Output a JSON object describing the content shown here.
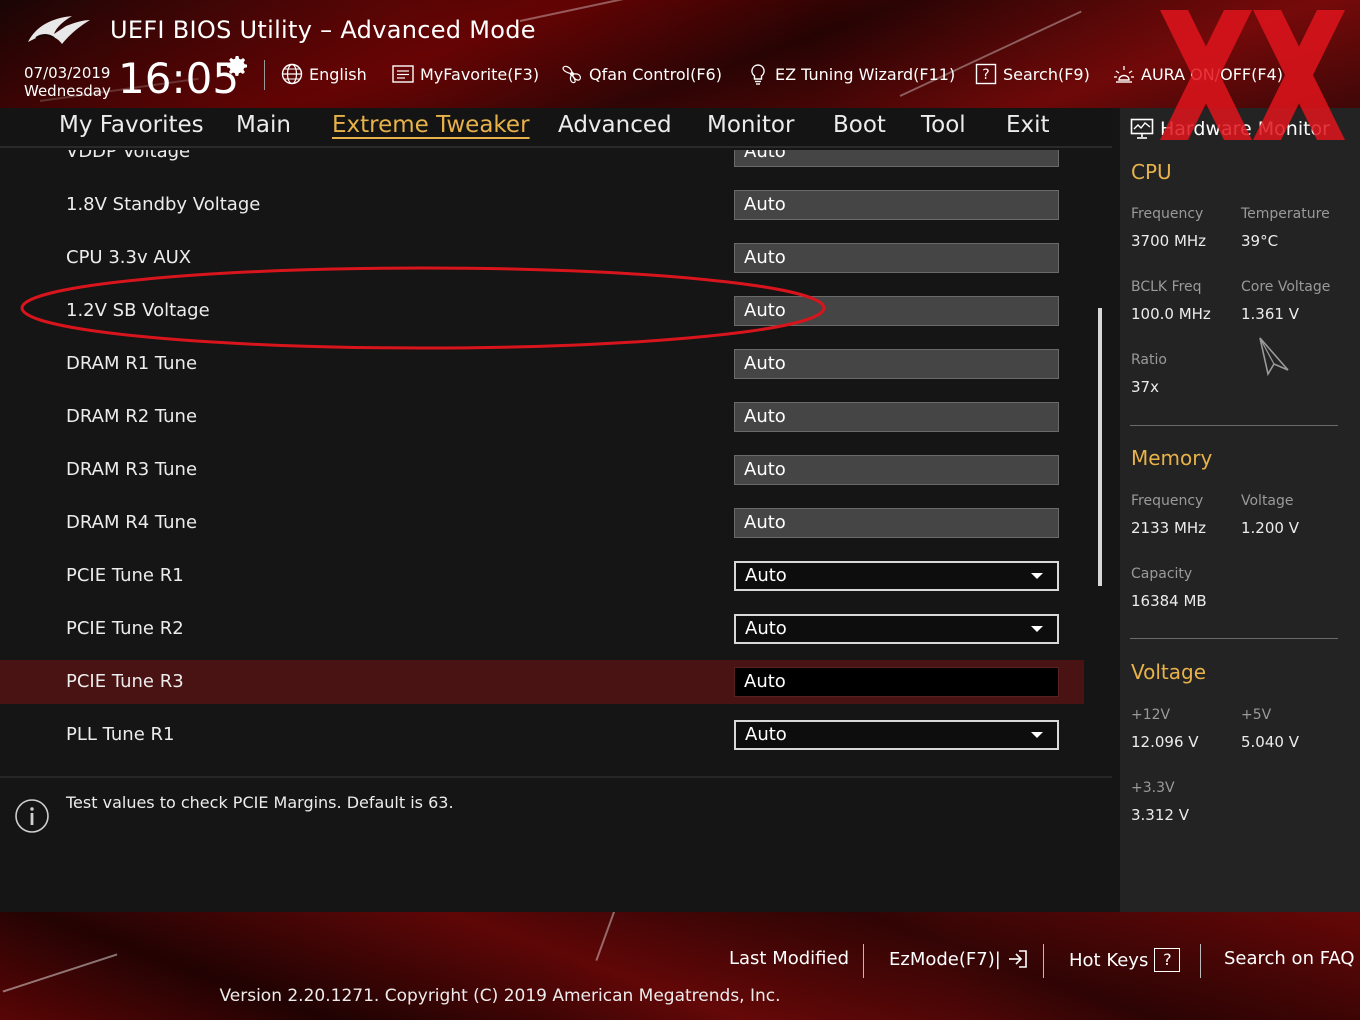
{
  "header": {
    "title": "UEFI BIOS Utility – Advanced Mode",
    "date": "07/03/2019",
    "weekday": "Wednesday",
    "time": "16:05",
    "tools": [
      {
        "label": "English",
        "icon": "globe-icon"
      },
      {
        "label": "MyFavorite(F3)",
        "icon": "favorite-list-icon"
      },
      {
        "label": "Qfan Control(F6)",
        "icon": "fan-icon"
      },
      {
        "label": "EZ Tuning Wizard(F11)",
        "icon": "lightbulb-icon"
      },
      {
        "label": "Search(F9)",
        "icon": "question-box-icon"
      },
      {
        "label": "AURA ON/OFF(F4)",
        "icon": "aura-light-icon"
      }
    ]
  },
  "tabs": [
    {
      "label": "My Favorites",
      "active": false
    },
    {
      "label": "Main",
      "active": false
    },
    {
      "label": "Extreme Tweaker",
      "active": true
    },
    {
      "label": "Advanced",
      "active": false
    },
    {
      "label": "Monitor",
      "active": false
    },
    {
      "label": "Boot",
      "active": false
    },
    {
      "label": "Tool",
      "active": false
    },
    {
      "label": "Exit",
      "active": false
    }
  ],
  "settings": [
    {
      "label": "VDDP Voltage",
      "value": "Auto",
      "kind": "text",
      "selected": false
    },
    {
      "label": "1.8V Standby Voltage",
      "value": "Auto",
      "kind": "text",
      "selected": false
    },
    {
      "label": "CPU 3.3v AUX",
      "value": "Auto",
      "kind": "text",
      "selected": false
    },
    {
      "label": "1.2V SB Voltage",
      "value": "Auto",
      "kind": "text",
      "selected": false
    },
    {
      "label": "DRAM R1 Tune",
      "value": "Auto",
      "kind": "text",
      "selected": false
    },
    {
      "label": "DRAM R2 Tune",
      "value": "Auto",
      "kind": "text",
      "selected": false
    },
    {
      "label": "DRAM R3 Tune",
      "value": "Auto",
      "kind": "text",
      "selected": false
    },
    {
      "label": "DRAM R4 Tune",
      "value": "Auto",
      "kind": "text",
      "selected": false
    },
    {
      "label": "PCIE Tune R1",
      "value": "Auto",
      "kind": "dropdown",
      "selected": false
    },
    {
      "label": "PCIE Tune R2",
      "value": "Auto",
      "kind": "dropdown",
      "selected": false
    },
    {
      "label": "PCIE Tune R3",
      "value": "Auto",
      "kind": "active",
      "selected": true
    },
    {
      "label": "PLL Tune R1",
      "value": "Auto",
      "kind": "dropdown",
      "selected": false
    }
  ],
  "help": {
    "text": "Test values to check PCIE Margins. Default is 63."
  },
  "hardware_monitor": {
    "title": "Hardware Monitor",
    "cpu": {
      "heading": "CPU",
      "frequency_label": "Frequency",
      "frequency": "3700 MHz",
      "temperature_label": "Temperature",
      "temperature": "39°C",
      "bclk_label": "BCLK Freq",
      "bclk": "100.0 MHz",
      "core_voltage_label": "Core Voltage",
      "core_voltage": "1.361 V",
      "ratio_label": "Ratio",
      "ratio": "37x"
    },
    "memory": {
      "heading": "Memory",
      "frequency_label": "Frequency",
      "frequency": "2133 MHz",
      "voltage_label": "Voltage",
      "voltage": "1.200 V",
      "capacity_label": "Capacity",
      "capacity": "16384 MB"
    },
    "voltage": {
      "heading": "Voltage",
      "v12_label": "+12V",
      "v12": "12.096 V",
      "v5_label": "+5V",
      "v5": "5.040 V",
      "v33_label": "+3.3V",
      "v33": "3.312 V"
    }
  },
  "footer": {
    "last_modified": "Last Modified",
    "ezmode": "EzMode(F7)|",
    "hot_keys": "Hot Keys",
    "hot_keys_box": "?",
    "search_faq": "Search on FAQ",
    "copyright": "Version 2.20.1271. Copyright (C) 2019 American Megatrends, Inc."
  },
  "colors": {
    "accent": "#e7b24a",
    "selected_row": "#4a1313",
    "annotation": "#d8141c"
  }
}
